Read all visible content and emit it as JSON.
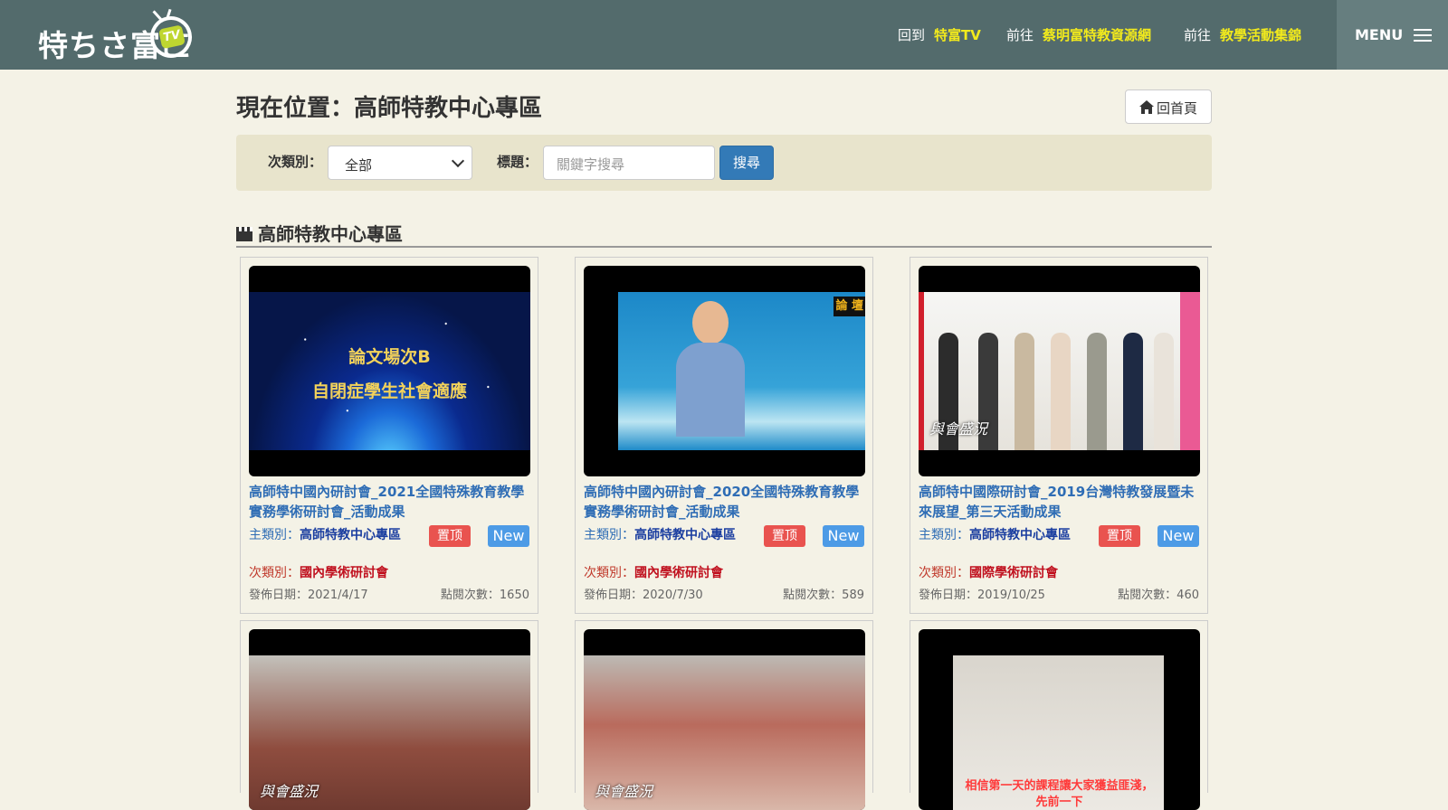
{
  "header": {
    "logo_text": "特ちさ富ㄈ",
    "logo_tv": "TV",
    "nav": [
      {
        "prefix": "回到",
        "label": "特富TV"
      },
      {
        "prefix": "前往",
        "label": "蔡明富特教資源網"
      },
      {
        "prefix": "前往",
        "label": "教學活動集錦"
      }
    ],
    "menu_label": "MENU"
  },
  "page": {
    "title": "現在位置：高師特教中心專區",
    "home_button": "回首頁"
  },
  "filter": {
    "subcategory_label": "次類別：",
    "subcategory_value": "全部",
    "title_label": "標題：",
    "keyword_placeholder": "關鍵字搜尋",
    "search_button": "搜尋"
  },
  "section": {
    "title": "高師特教中心專區"
  },
  "cards": [
    {
      "thumb_line1": "論文場次B",
      "thumb_line2": "自閉症學生社會適應",
      "title": "高師特中國內研討會_2021全國特殊教育教學實務學術研討會_活動成果",
      "main_label": "主類別：",
      "main_value": "高師特教中心專區",
      "sub_label": "次類別：",
      "sub_value": "國內學術研討會",
      "badge_top": "置顶",
      "badge_new": "New",
      "date": "發佈日期：2021/4/17",
      "views": "點閱次數：1650"
    },
    {
      "thumb_tag": "論 壇",
      "title": "高師特中國內研討會_2020全國特殊教育教學實務學術研討會_活動成果",
      "main_label": "主類別：",
      "main_value": "高師特教中心專區",
      "sub_label": "次類別：",
      "sub_value": "國內學術研討會",
      "badge_top": "置顶",
      "badge_new": "New",
      "date": "發佈日期：2020/7/30",
      "views": "點閱次數：589"
    },
    {
      "thumb_caption": "與會盛況",
      "title": "高師特中國際研討會_2019台灣特教發展暨未來展望_第三天活動成果",
      "main_label": "主類別：",
      "main_value": "高師特教中心專區",
      "sub_label": "次類別：",
      "sub_value": "國際學術研討會",
      "badge_top": "置顶",
      "badge_new": "New",
      "date": "發佈日期：2019/10/25",
      "views": "點閱次數：460"
    }
  ],
  "cards_row2": [
    {
      "thumb_caption": "與會盛況"
    },
    {
      "thumb_caption": "與會盛況"
    },
    {
      "thumb_sub1": "相信第一天的課程讓大家獲益匪淺，",
      "thumb_sub2": "先前一下"
    }
  ],
  "colors": {
    "header_bg": "#536b6c",
    "nav_link": "#f2ea1c",
    "page_bg": "#f4f2e6",
    "filter_bg": "#e8e4cc",
    "primary": "#337ab7",
    "badge_top": "#e9534f",
    "badge_new": "#4d9be6"
  },
  "icons": [
    "hamburger-icon",
    "home-icon",
    "clapperboard-icon",
    "chevron-down-icon"
  ]
}
